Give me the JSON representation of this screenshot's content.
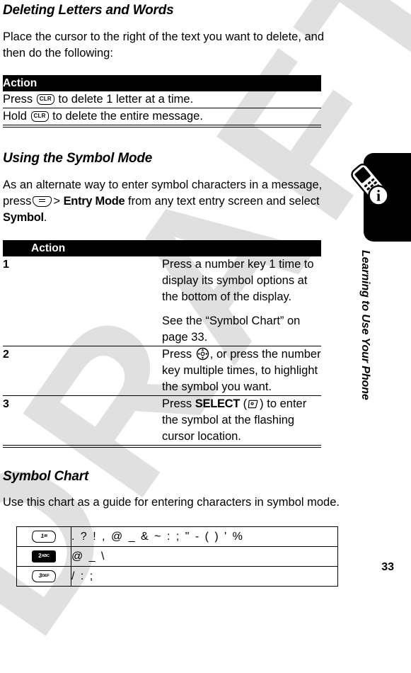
{
  "watermark": {
    "text": "DRAFT"
  },
  "sections": {
    "deleting": {
      "heading": "Deleting Letters and Words",
      "intro": "Place the cursor to the right of the text you want to delete, and then do the following:",
      "table": {
        "header": "Action",
        "rows": [
          {
            "pre": "Press",
            "key": "CLR",
            "post": "to delete 1 letter at a time."
          },
          {
            "pre": "Hold",
            "key": "CLR",
            "post": "to delete the entire message."
          }
        ]
      }
    },
    "symbol_mode": {
      "heading": "Using the Symbol Mode",
      "intro_part1": "As an alternate way to enter symbol characters in a message, press",
      "intro_menu_key": "menu-key",
      "intro_separator": ">",
      "intro_bold1": "Entry Mode",
      "intro_part2": "from any text entry screen and select",
      "intro_bold2": "Symbol",
      "intro_end": ".",
      "table": {
        "header": "Action",
        "rows": [
          {
            "number": "1",
            "line1": "Press a number key 1 time to display its symbol options at the bottom of the display.",
            "line2": "See the “Symbol Chart” on page 33."
          },
          {
            "number": "2",
            "pre": "Press",
            "key": "nav-key",
            "post": ", or press the number key multiple times, to highlight the symbol you want."
          },
          {
            "number": "3",
            "pre": "Press",
            "bold": "SELECT",
            "paren_open": "(",
            "key": "soft-key",
            "paren_close": ")",
            "post": "to enter the symbol at the flashing cursor location."
          }
        ]
      }
    },
    "symbol_chart": {
      "heading": "Symbol Chart",
      "intro": "Use this chart as a guide for entering characters in symbol mode.",
      "rows": [
        {
          "key_digit": "1",
          "key_sub": "✉",
          "key_style": "outline",
          "chars": ". ? ! , @ _ & ~ : ; \" - ( ) ' %"
        },
        {
          "key_digit": "2",
          "key_sub": "ABC",
          "key_style": "filled",
          "chars": "@ _ \\"
        },
        {
          "key_digit": "3",
          "key_sub": "DEF",
          "key_style": "outline",
          "chars": "/ : ;"
        }
      ]
    }
  },
  "margin": {
    "chapter_label": "Learning to Use Your Phone",
    "icon_name": "phone-info-icon",
    "page_number": "33"
  },
  "colors": {
    "ink": "#000000",
    "paper": "#ffffff",
    "watermark": "#e0e0e0"
  }
}
